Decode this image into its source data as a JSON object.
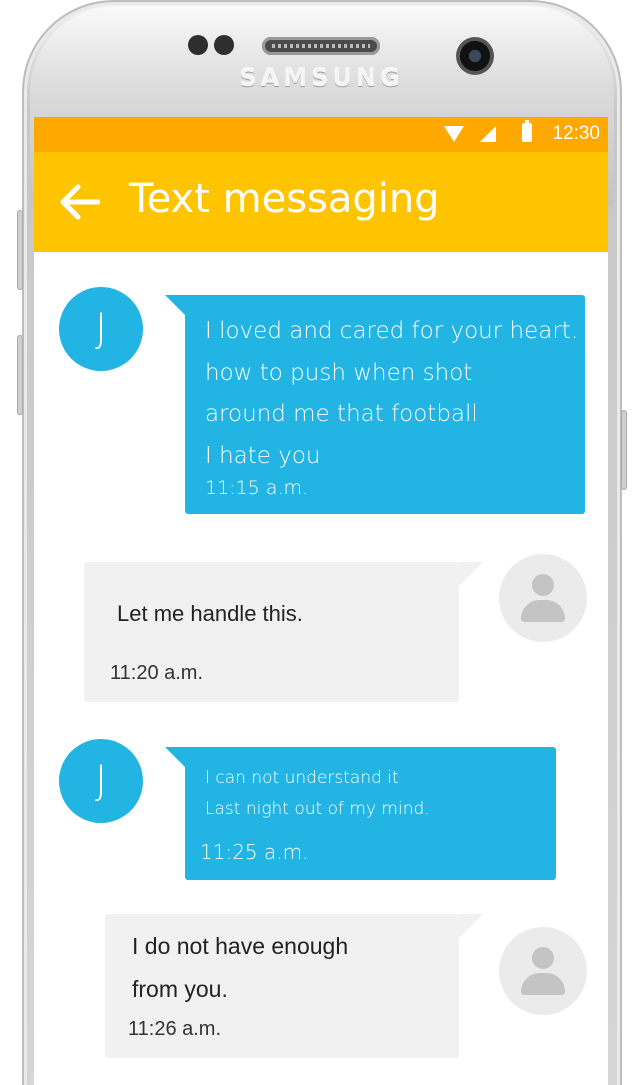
{
  "device": {
    "brand": "SAMSUNG"
  },
  "status_bar": {
    "time": "12:30",
    "color": "#ffa800"
  },
  "app_bar": {
    "title": "Text messaging",
    "color": "#ffc400"
  },
  "colors": {
    "incoming_bubble": "#22b5e4",
    "outgoing_bubble": "#f1f1f1",
    "avatar_contact": "#22b4e3"
  },
  "messages": [
    {
      "sender": "contact",
      "avatar_letter": "J",
      "lines": [
        "I loved and cared for your heart.",
        "how to push when shot",
        "around me that football",
        "I hate you"
      ],
      "time": "11:15 a.m."
    },
    {
      "sender": "me",
      "avatar_icon": "user-icon",
      "lines": [
        "Let me handle this."
      ],
      "time": "11:20 a.m."
    },
    {
      "sender": "contact",
      "avatar_letter": "J",
      "lines": [
        "I can not understand it",
        "Last night out of my mind."
      ],
      "time": "11:25 a.m."
    },
    {
      "sender": "me",
      "avatar_icon": "user-icon",
      "lines": [
        "I do not have enough",
        "from you."
      ],
      "time": "11:26 a.m."
    }
  ]
}
